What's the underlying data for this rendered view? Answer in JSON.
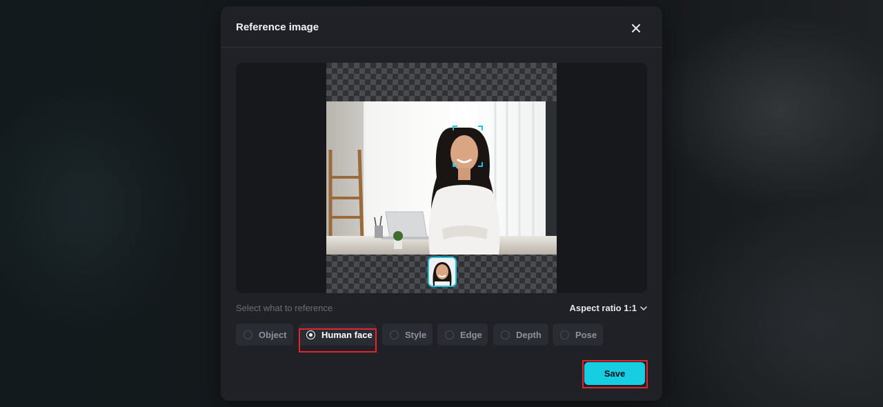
{
  "modal": {
    "title": "Reference image",
    "close_icon": "close-icon"
  },
  "preview": {
    "image_description_icon": "portrait-photo",
    "face_thumbnail_icon": "face-thumbnail"
  },
  "reference": {
    "label": "Select what to reference",
    "aspect_ratio_label": "Aspect ratio 1:1",
    "aspect_ratio_icon": "chevron-down-icon",
    "options": [
      {
        "label": "Object",
        "selected": false
      },
      {
        "label": "Human face",
        "selected": true
      },
      {
        "label": "Style",
        "selected": false
      },
      {
        "label": "Edge",
        "selected": false
      },
      {
        "label": "Depth",
        "selected": false
      },
      {
        "label": "Pose",
        "selected": false
      }
    ]
  },
  "actions": {
    "save_label": "Save"
  },
  "colors": {
    "accent": "#16cde2",
    "highlight": "#e8232c",
    "modal_bg": "#1f2127"
  }
}
